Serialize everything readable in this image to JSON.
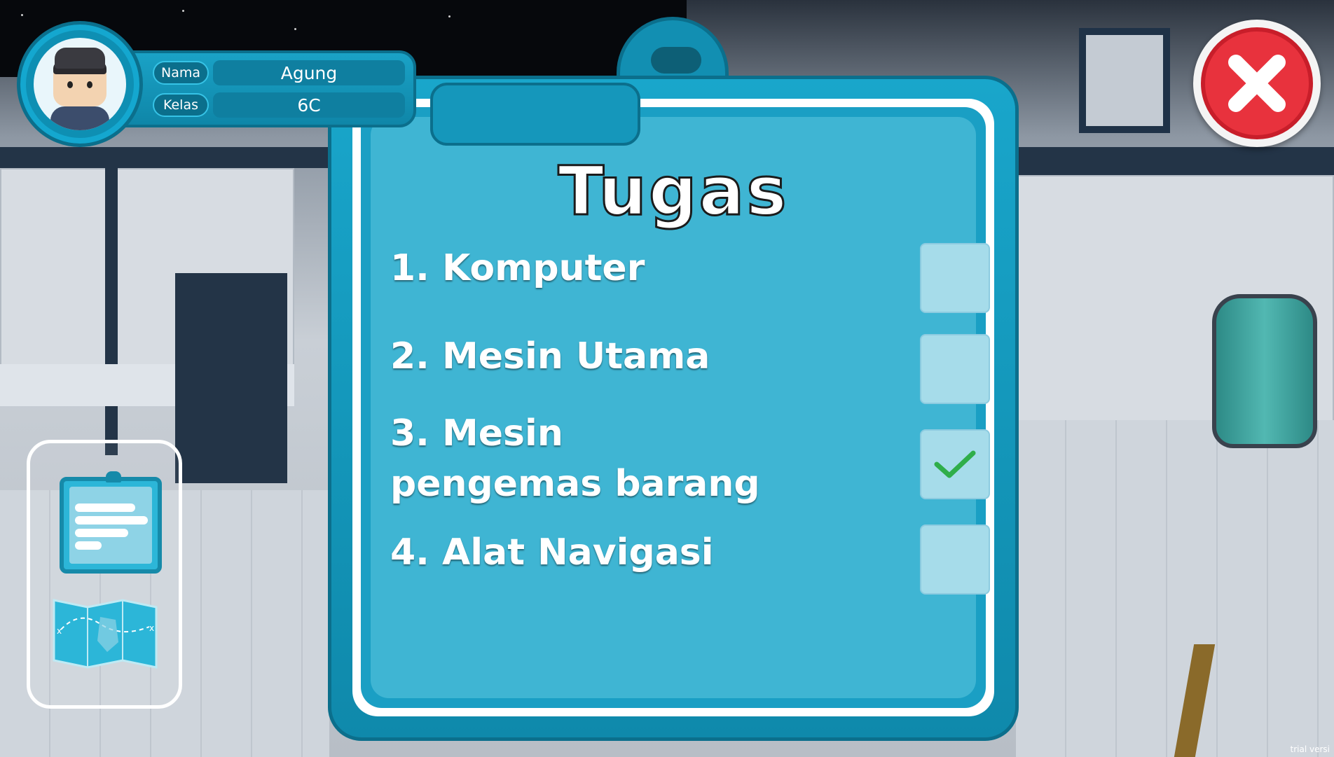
{
  "player": {
    "name_label": "Nama",
    "name_value": "Agung",
    "class_label": "Kelas",
    "class_value": "6C"
  },
  "board": {
    "title": "Tugas",
    "tasks": [
      {
        "label": "1. Komputer",
        "done": false
      },
      {
        "label": "2. Mesin Utama",
        "done": false
      },
      {
        "label": "3. Mesin pengemas barang",
        "done": true
      },
      {
        "label": "4. Alat Navigasi",
        "done": false
      }
    ]
  },
  "sidebar": {
    "buttons": [
      {
        "icon": "clipboard-icon"
      },
      {
        "icon": "map-icon"
      }
    ]
  },
  "close_button": {
    "icon": "close-icon",
    "color": "#e8323d"
  },
  "footer": {
    "watermark": "trial versi"
  },
  "colors": {
    "panel_blue": "#3fb5d3",
    "frame_blue": "#19a6cb",
    "checkbox": "#a6dcea",
    "check_green": "#2fae4a"
  }
}
